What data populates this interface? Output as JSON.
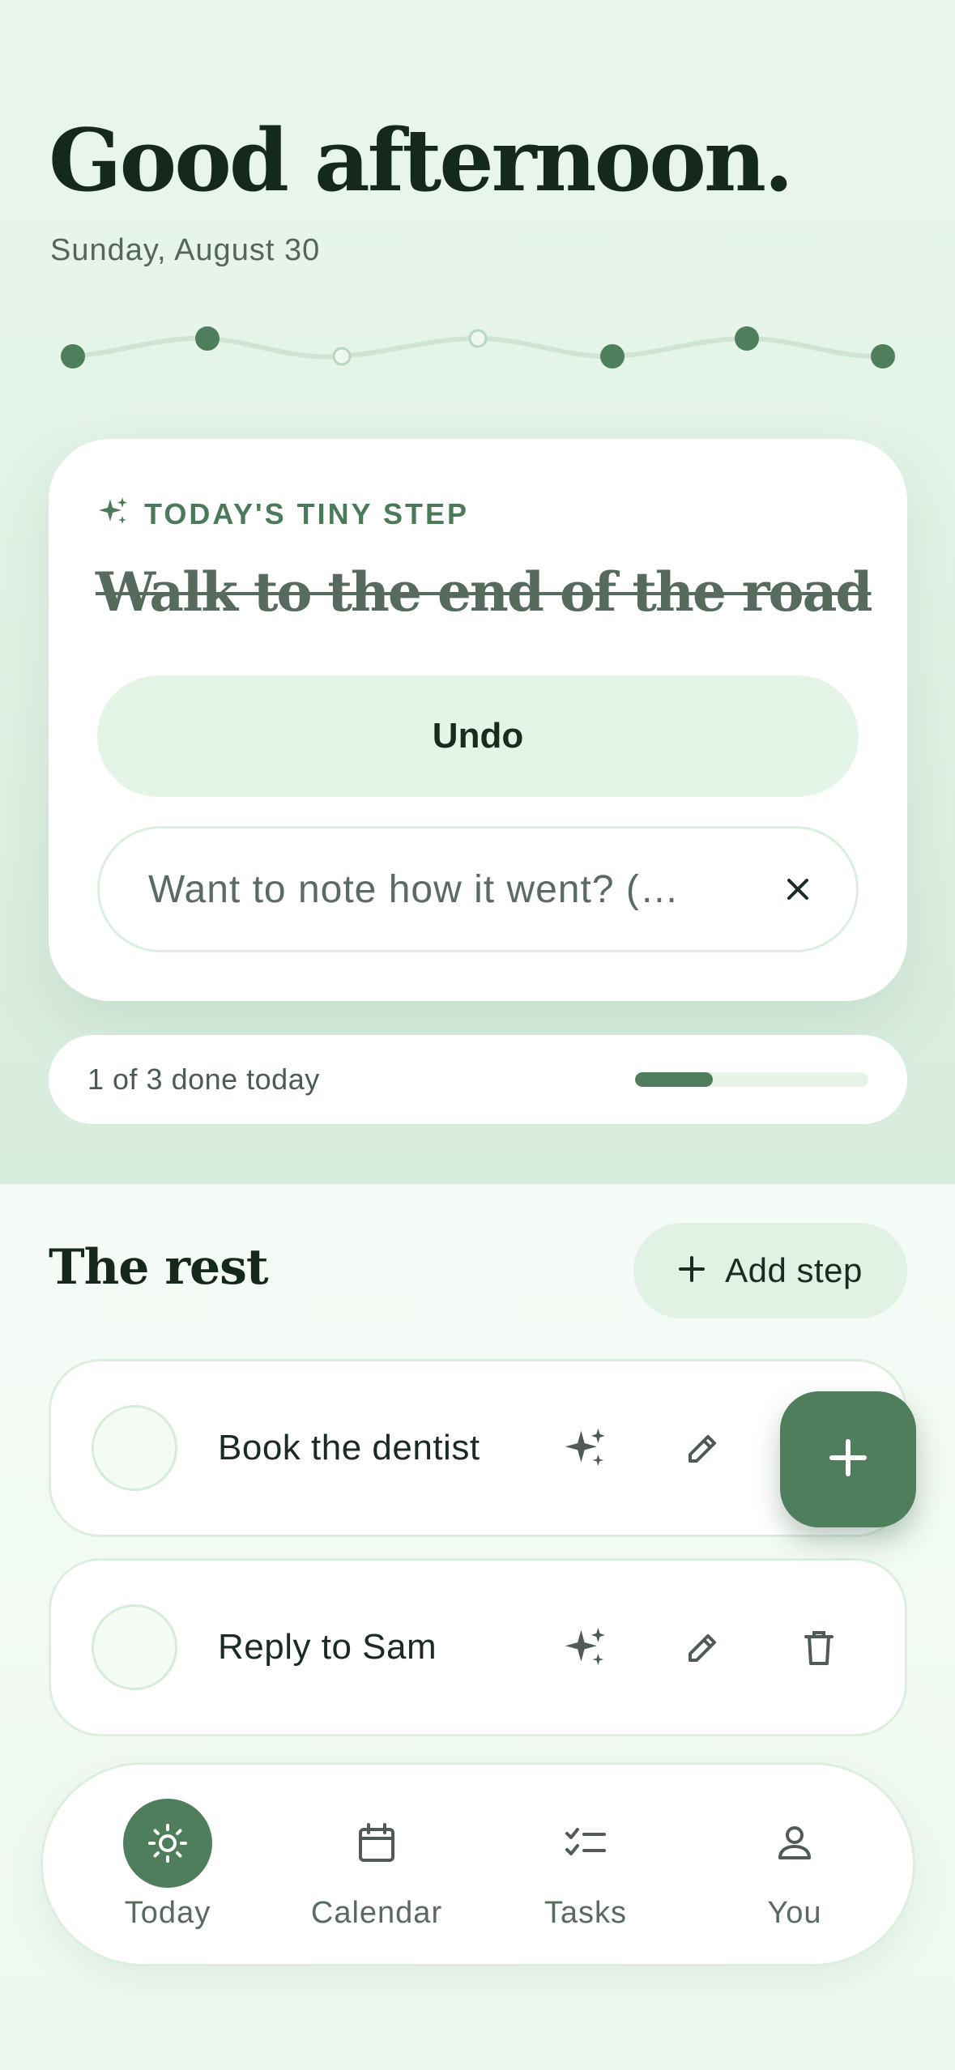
{
  "header": {
    "greeting": "Good afternoon.",
    "date": "Sunday, August 30"
  },
  "tiny_step": {
    "label": "TODAY'S TINY STEP",
    "title": "Walk to the end of the road",
    "completed": true,
    "undo_label": "Undo",
    "note_placeholder": "Want to note how it went? (…"
  },
  "progress": {
    "text": "1 of 3 done today",
    "done": 1,
    "total": 3
  },
  "rest": {
    "title": "The rest",
    "add_step_label": "Add step",
    "tasks": [
      {
        "label": "Book the dentist"
      },
      {
        "label": "Reply to Sam"
      }
    ]
  },
  "nav": {
    "items": [
      {
        "label": "Today",
        "icon": "sun-icon",
        "active": true
      },
      {
        "label": "Calendar",
        "icon": "calendar-icon",
        "active": false
      },
      {
        "label": "Tasks",
        "icon": "tasks-icon",
        "active": false
      },
      {
        "label": "You",
        "icon": "person-icon",
        "active": false
      }
    ]
  },
  "colors": {
    "accent": "#4f7e5d",
    "accent_light": "#e4f4e6",
    "background": "#e9f6ec"
  },
  "icons": {
    "sparkle": "sparkle-icon",
    "close": "close-icon",
    "plus": "plus-icon",
    "edit": "pencil-icon",
    "delete": "trash-icon"
  }
}
